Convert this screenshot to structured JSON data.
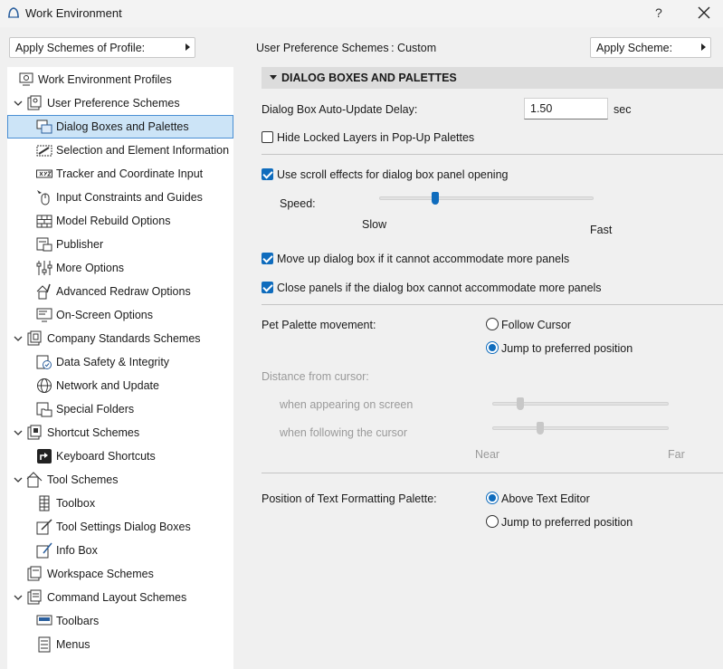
{
  "window": {
    "title": "Work Environment",
    "help": "?"
  },
  "toolbar": {
    "apply_profile_label": "Apply Schemes of Profile:",
    "scheme_label": "User Preference Schemes : Custom",
    "apply_scheme_label": "Apply Scheme:"
  },
  "tree": {
    "items": [
      {
        "label": "Work Environment Profiles"
      },
      {
        "label": "User Preference Schemes"
      },
      {
        "label": "Dialog Boxes and Palettes"
      },
      {
        "label": "Selection and Element Information"
      },
      {
        "label": "Tracker and Coordinate Input"
      },
      {
        "label": "Input Constraints and Guides"
      },
      {
        "label": "Model Rebuild Options"
      },
      {
        "label": "Publisher"
      },
      {
        "label": "More Options"
      },
      {
        "label": "Advanced Redraw Options"
      },
      {
        "label": "On-Screen Options"
      },
      {
        "label": "Company Standards Schemes"
      },
      {
        "label": "Data Safety & Integrity"
      },
      {
        "label": "Network and Update"
      },
      {
        "label": "Special Folders"
      },
      {
        "label": "Shortcut Schemes"
      },
      {
        "label": "Keyboard Shortcuts"
      },
      {
        "label": "Tool Schemes"
      },
      {
        "label": "Toolbox"
      },
      {
        "label": "Tool Settings Dialog Boxes"
      },
      {
        "label": "Info Box"
      },
      {
        "label": "Workspace Schemes"
      },
      {
        "label": "Command Layout Schemes"
      },
      {
        "label": "Toolbars"
      },
      {
        "label": "Menus"
      }
    ]
  },
  "panel": {
    "section_title": "DIALOG BOXES AND PALETTES",
    "auto_update": {
      "label": "Dialog Box Auto-Update Delay:",
      "value": "1.50",
      "unit": "sec"
    },
    "hide_locked": {
      "label": "Hide Locked Layers in Pop-Up Palettes",
      "checked": false
    },
    "scroll_effects": {
      "label": "Use scroll effects for dialog box panel opening",
      "checked": true
    },
    "speed": {
      "label": "Speed:",
      "min_label": "Slow",
      "max_label": "Fast",
      "level": 0.26
    },
    "move_up": {
      "label": "Move up dialog box if it cannot accommodate more panels",
      "checked": true
    },
    "close_panels": {
      "label": "Close panels if the dialog box cannot accommodate more panels",
      "checked": true
    },
    "pet_palette": {
      "label": "Pet Palette movement:",
      "options": [
        "Follow Cursor",
        "Jump to preferred position"
      ],
      "selected": 1
    },
    "distance": {
      "label": "Distance from cursor:",
      "appearing_label": "when appearing on screen",
      "appearing_level": 0.16,
      "following_label": "when following the cursor",
      "following_level": 0.27,
      "min_label": "Near",
      "max_label": "Far"
    },
    "text_palette": {
      "label": "Position of Text Formatting Palette:",
      "options": [
        "Above Text Editor",
        "Jump to preferred position"
      ],
      "selected": 0
    }
  },
  "colors": {
    "accent": "#0f6cbd",
    "selection_bg": "#cce4f7"
  }
}
